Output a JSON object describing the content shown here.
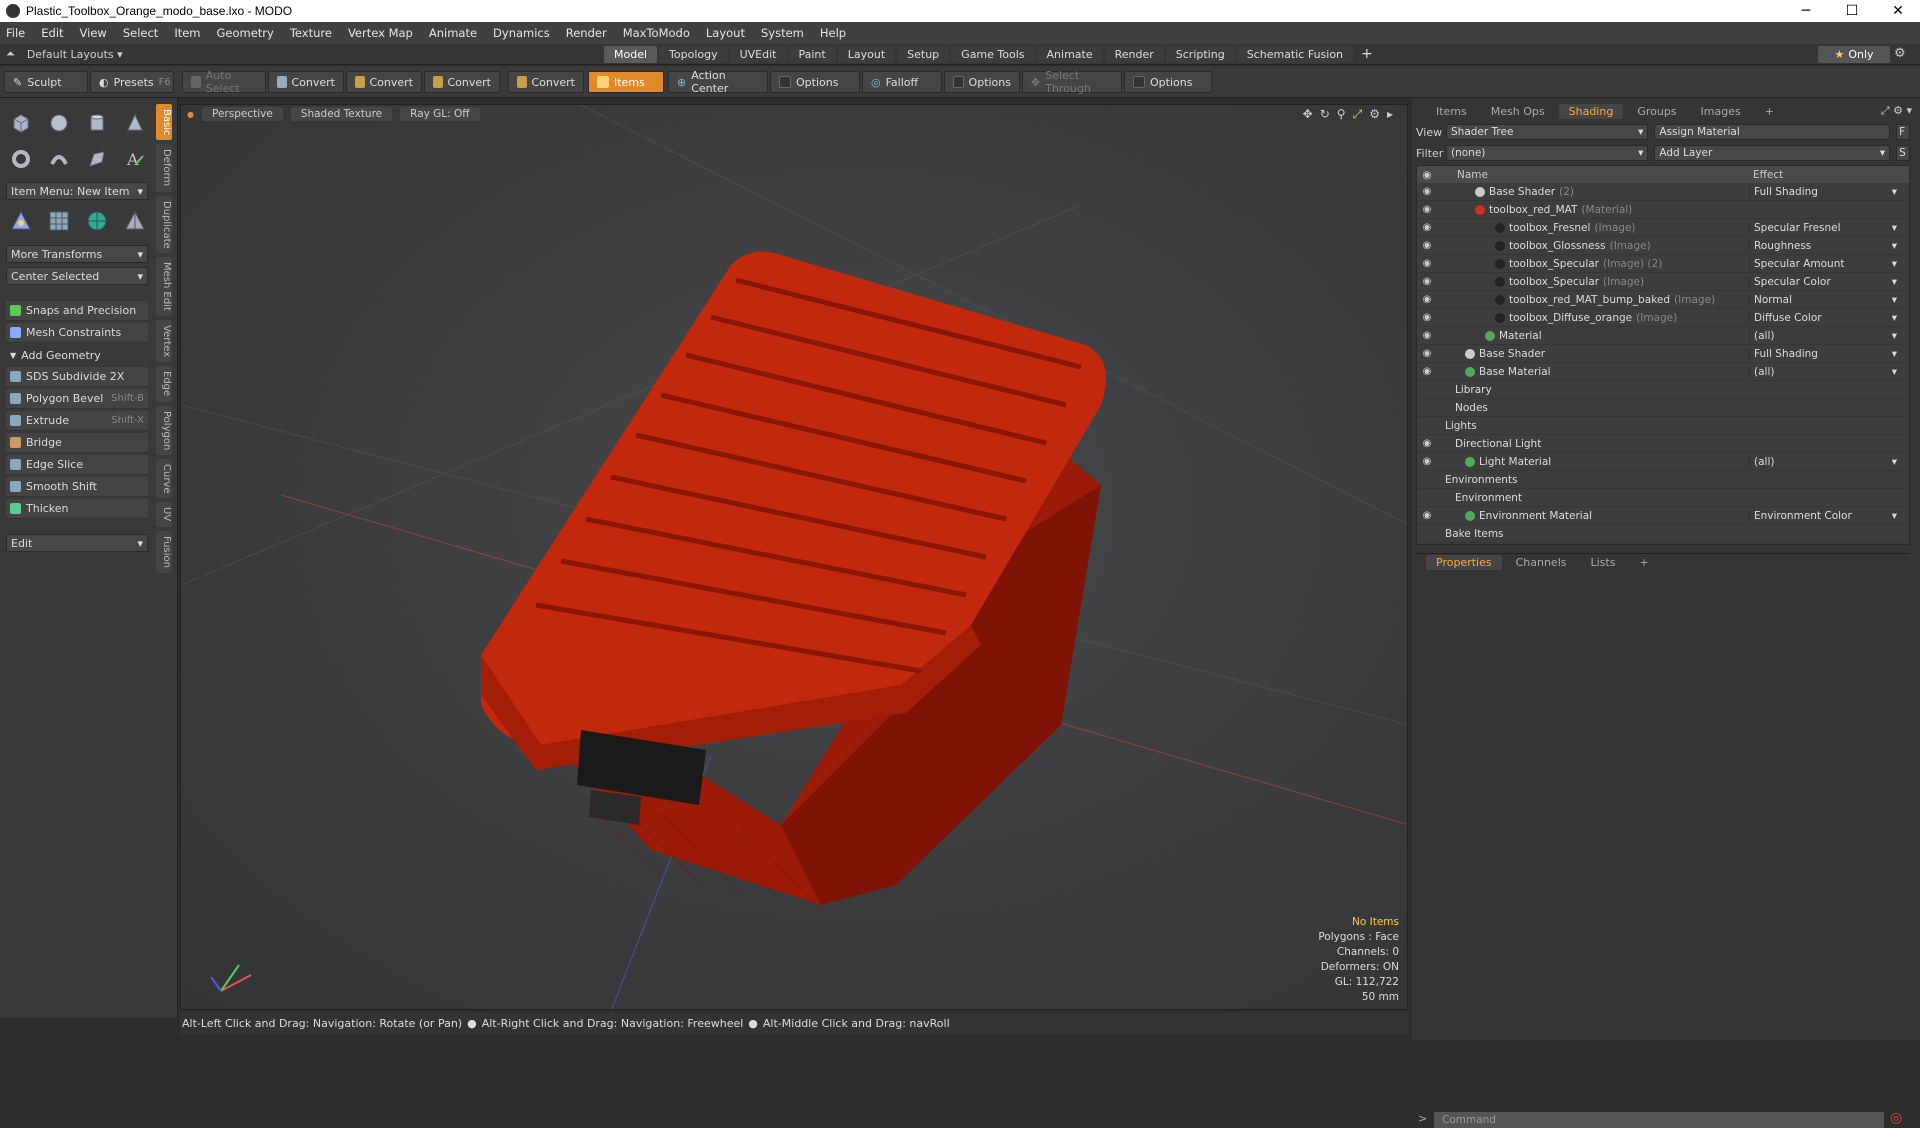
{
  "window": {
    "title": "Plastic_Toolbox_Orange_modo_base.lxo - MODO",
    "minimize": "─",
    "maximize": "☐",
    "close": "✕"
  },
  "menu": [
    "File",
    "Edit",
    "View",
    "Select",
    "Item",
    "Geometry",
    "Texture",
    "Vertex Map",
    "Animate",
    "Dynamics",
    "Render",
    "MaxToModo",
    "Layout",
    "System",
    "Help"
  ],
  "layoutbar": {
    "layouts": "Default Layouts",
    "tabs": [
      "Model",
      "Topology",
      "UVEdit",
      "Paint",
      "Layout",
      "Setup",
      "Game Tools",
      "Animate",
      "Render",
      "Scripting",
      "Schematic Fusion"
    ],
    "active_tab": "Model",
    "add": "+",
    "only": "Only"
  },
  "toolbar": {
    "sculpt": "Sculpt",
    "presets": "Presets",
    "presets_key": "F6",
    "auto_select": "Auto Select",
    "convert1": "Convert",
    "convert2": "Convert",
    "convert3": "Convert",
    "convert4": "Convert",
    "items": "Items",
    "action_center": "Action Center",
    "options1": "Options",
    "falloff": "Falloff",
    "options2": "Options",
    "select_through": "Select Through",
    "options3": "Options"
  },
  "left": {
    "vtabs": [
      "Basic",
      "Deform",
      "Duplicate",
      "Mesh Edit",
      "Vertex",
      "Edge",
      "Polygon",
      "Curve",
      "UV",
      "Fusion"
    ],
    "item_menu": "Item Menu: New Item",
    "more_transforms": "More Transforms",
    "center_selected": "Center Selected",
    "snaps": "Snaps and Precision",
    "mesh_constraints": "Mesh Constraints",
    "add_geometry": "Add Geometry",
    "tools": [
      {
        "label": "SDS Subdivide 2X",
        "shortcut": ""
      },
      {
        "label": "Polygon Bevel",
        "shortcut": "Shift-B"
      },
      {
        "label": "Extrude",
        "shortcut": "Shift-X"
      },
      {
        "label": "Bridge",
        "shortcut": ""
      },
      {
        "label": "Edge Slice",
        "shortcut": ""
      },
      {
        "label": "Smooth Shift",
        "shortcut": ""
      },
      {
        "label": "Thicken",
        "shortcut": ""
      }
    ],
    "edit": "Edit"
  },
  "viewport": {
    "tabs": [
      "Perspective",
      "Shaded Texture",
      "Ray GL: Off"
    ],
    "info": {
      "no_items": "No Items",
      "polygons": "Polygons : Face",
      "channels": "Channels: 0",
      "deformers": "Deformers: ON",
      "gl": "GL: 112,722",
      "scale": "50 mm"
    }
  },
  "status": {
    "hint1": "Alt-Left Click and Drag: Navigation: Rotate (or Pan)",
    "hint2": "Alt-Right Click and Drag: Navigation: Freewheel",
    "hint3": "Alt-Middle Click and Drag: navRoll"
  },
  "right": {
    "tabs": [
      "Items",
      "Mesh Ops",
      "Shading",
      "Groups",
      "Images"
    ],
    "active_tab": "Shading",
    "view_label": "View",
    "view_value": "Shader Tree",
    "assign_material": "Assign Material",
    "filter_label": "Filter",
    "filter_value": "(none)",
    "add_layer": "Add Layer",
    "col_name": "Name",
    "col_effect": "Effect",
    "rows": [
      {
        "name": "Base Shader",
        "sub": "(2)",
        "effect": "Full Shading",
        "indent": 3,
        "ball": "#cccccc",
        "eye": true
      },
      {
        "name": "toolbox_red_MAT",
        "sub": "(Material)",
        "effect": "",
        "indent": 3,
        "ball": "#cc3322",
        "eye": true
      },
      {
        "name": "toolbox_Fresnel",
        "sub": "(Image)",
        "effect": "Specular Fresnel",
        "indent": 5,
        "ball": "#222222",
        "eye": true
      },
      {
        "name": "toolbox_Glossness",
        "sub": "(Image)",
        "effect": "Roughness",
        "indent": 5,
        "ball": "#222222",
        "eye": true
      },
      {
        "name": "toolbox_Specular",
        "sub": "(Image) (2)",
        "effect": "Specular Amount",
        "indent": 5,
        "ball": "#222222",
        "eye": true
      },
      {
        "name": "toolbox_Specular",
        "sub": "(Image)",
        "effect": "Specular Color",
        "indent": 5,
        "ball": "#222222",
        "eye": true
      },
      {
        "name": "toolbox_red_MAT_bump_baked",
        "sub": "(Image)",
        "effect": "Normal",
        "indent": 5,
        "ball": "#222222",
        "eye": true
      },
      {
        "name": "toolbox_Diffuse_orange",
        "sub": "(Image)",
        "effect": "Diffuse Color",
        "indent": 5,
        "ball": "#222222",
        "eye": true
      },
      {
        "name": "Material",
        "sub": "",
        "effect": "(all)",
        "indent": 4,
        "ball": "#55aa55",
        "eye": true
      },
      {
        "name": "Base Shader",
        "sub": "",
        "effect": "Full Shading",
        "indent": 2,
        "ball": "#cccccc",
        "eye": true
      },
      {
        "name": "Base Material",
        "sub": "",
        "effect": "(all)",
        "indent": 2,
        "ball": "#55aa55",
        "eye": true
      },
      {
        "name": "Library",
        "sub": "",
        "effect": "",
        "indent": 1,
        "ball": "",
        "eye": false
      },
      {
        "name": "Nodes",
        "sub": "",
        "effect": "",
        "indent": 1,
        "ball": "",
        "eye": false
      },
      {
        "name": "Lights",
        "sub": "",
        "effect": "",
        "indent": 0,
        "ball": "",
        "eye": false
      },
      {
        "name": "Directional Light",
        "sub": "",
        "effect": "",
        "indent": 1,
        "ball": "",
        "eye": true
      },
      {
        "name": "Light Material",
        "sub": "",
        "effect": "(all)",
        "indent": 2,
        "ball": "#55aa55",
        "eye": true
      },
      {
        "name": "Environments",
        "sub": "",
        "effect": "",
        "indent": 0,
        "ball": "",
        "eye": false
      },
      {
        "name": "Environment",
        "sub": "",
        "effect": "",
        "indent": 1,
        "ball": "",
        "eye": false
      },
      {
        "name": "Environment Material",
        "sub": "",
        "effect": "Environment Color",
        "indent": 2,
        "ball": "#55aa55",
        "eye": true
      },
      {
        "name": "Bake Items",
        "sub": "",
        "effect": "",
        "indent": 0,
        "ball": "",
        "eye": false
      }
    ],
    "props_tabs": [
      "Properties",
      "Channels",
      "Lists"
    ],
    "command_placeholder": "Command"
  }
}
